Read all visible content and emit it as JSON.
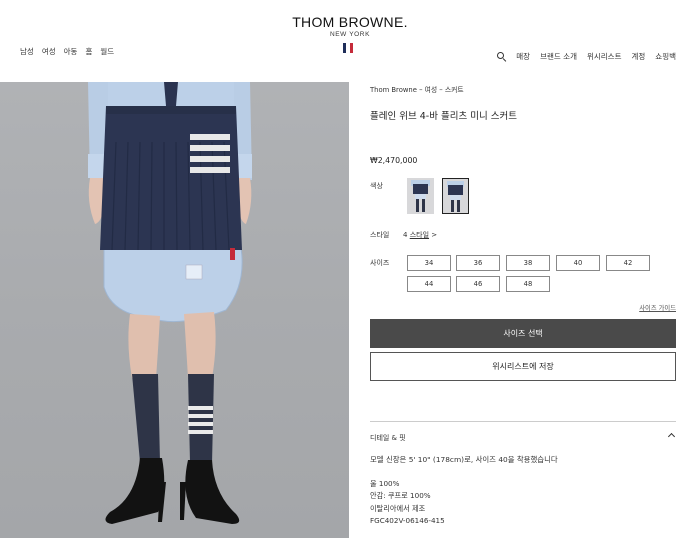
{
  "brand": {
    "name": "THOM BROWNE.",
    "sub": "NEW YORK"
  },
  "nav_left": [
    "남성",
    "여성",
    "아동",
    "홈",
    "월드"
  ],
  "nav_right": [
    "매장",
    "브랜드 소개",
    "위시리스트",
    "계정",
    "쇼핑백"
  ],
  "breadcrumb": "Thom Browne – 여성 – 스커트",
  "product": {
    "title": "플레인 위브 4-바 플리츠 미니 스커트",
    "price": "₩2,470,000"
  },
  "color": {
    "label": "색상"
  },
  "style": {
    "label": "스타일",
    "count": "4",
    "link": "스타일",
    "arrow": ">"
  },
  "sizes": {
    "label": "사이즈",
    "options": [
      "34",
      "36",
      "38",
      "40",
      "42",
      "44",
      "46",
      "48"
    ]
  },
  "size_guide": "사이즈 가이드",
  "buttons": {
    "select_size": "사이즈 선택",
    "wishlist": "위시리스트에 저장"
  },
  "details": {
    "title": "디테일 & 핏",
    "model": "모델 신장은 5' 10\" (178cm)로, 사이즈 40을 착용했습니다",
    "specs": [
      "울 100%",
      "안감: 쿠프로 100%",
      "이탈리아에서 제조",
      "FGC402V-06146-415"
    ]
  },
  "colors": {
    "navy": "#2b3550",
    "shirt": "#b8cde6",
    "dark_button": "#4a4a4a"
  },
  "icons": {
    "search": "search-icon",
    "flag": "tricolor-flag-icon",
    "collapse": "chevron-up-icon"
  }
}
